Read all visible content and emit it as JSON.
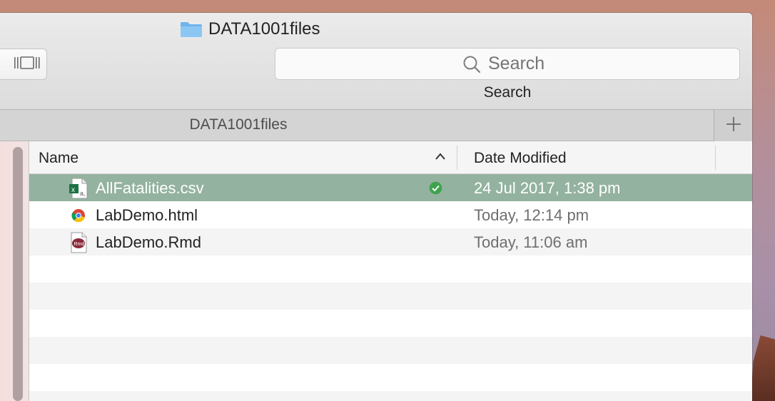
{
  "window": {
    "title": "DATA1001files"
  },
  "toolbar": {
    "search_placeholder": "Search",
    "search_caption": "Search"
  },
  "tabs": [
    {
      "label": "DATA1001files"
    }
  ],
  "columns": {
    "name": "Name",
    "date_modified": "Date Modified"
  },
  "files": [
    {
      "name": "AllFatalities.csv",
      "date": "24 Jul 2017, 1:38 pm",
      "icon": "excel-csv-file-icon",
      "selected": true,
      "synced": true
    },
    {
      "name": "LabDemo.html",
      "date": "Today, 12:14 pm",
      "icon": "chrome-html-file-icon",
      "selected": false
    },
    {
      "name": "LabDemo.Rmd",
      "date": "Today, 11:06 am",
      "icon": "rmd-file-icon",
      "selected": false
    }
  ],
  "colors": {
    "selection": "#93b29f",
    "folder": "#6fb5ec",
    "sync_badge": "#3fa34d",
    "excel": "#1e7145",
    "rmd": "#8a2a3a"
  }
}
